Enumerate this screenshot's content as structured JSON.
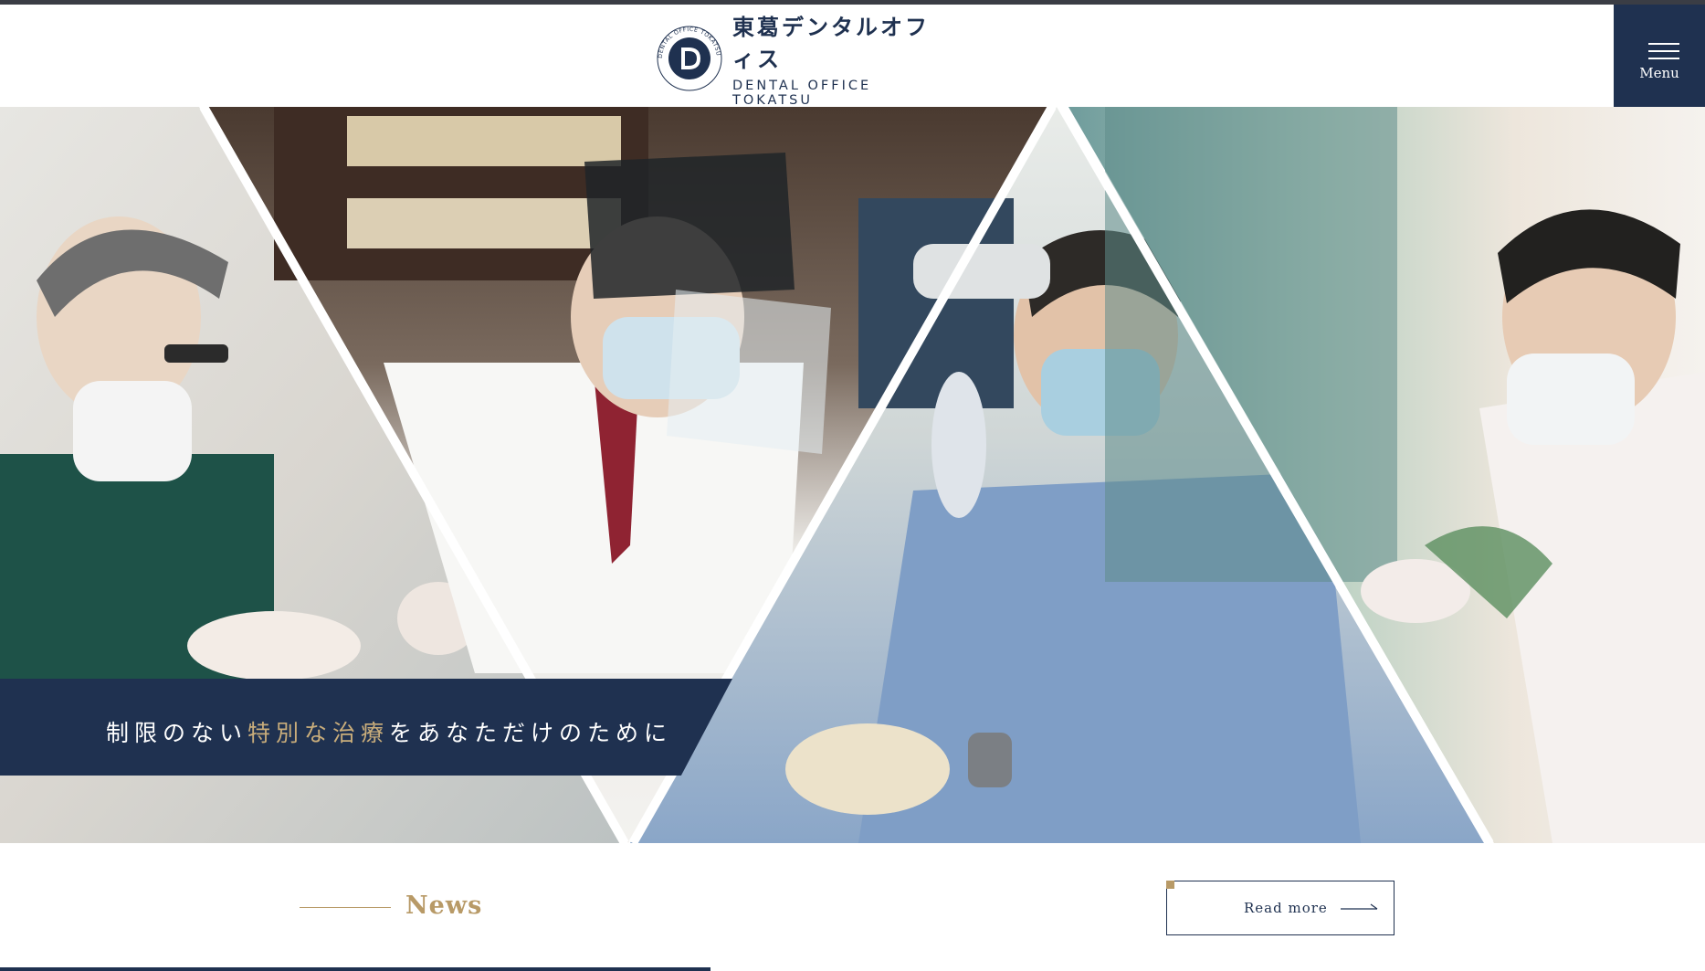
{
  "header": {
    "logo_jp": "東葛デンタルオフィス",
    "logo_en": "DENTAL OFFICE TOKATSU",
    "seal_text": "DENTAL OFFICE TOKATSU",
    "menu_label": "Menu"
  },
  "hero": {
    "tagline_before": "制限のない",
    "tagline_accent": "特別な治療",
    "tagline_after": "をあなただけのために",
    "photos": [
      "dentist-with-loupes-in-green-scrubs",
      "dentist-with-headlamp-and-face-shield",
      "dentist-at-microscope-in-blue-scrubs",
      "dentist-in-white-coat-by-window"
    ]
  },
  "news": {
    "title": "News",
    "read_more": "Read more"
  },
  "colors": {
    "navy": "#1f3150",
    "gold": "#b89a67",
    "accent_text": "#c9ad7b"
  },
  "icons": {
    "menu": "hamburger-icon",
    "arrow": "arrow-right-icon",
    "logo": "dental-d-logo-icon"
  }
}
